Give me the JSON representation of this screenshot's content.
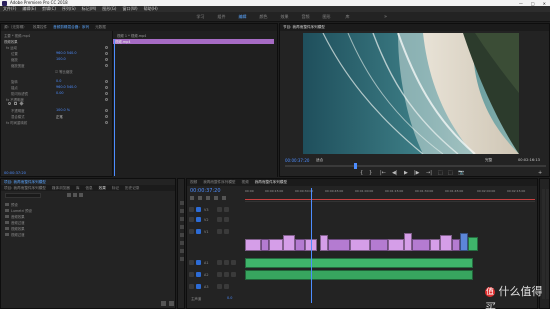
{
  "app": {
    "title": "Adobe Premiere Pro CC 2018",
    "menu": [
      "文件(F)",
      "编辑(E)",
      "剪辑(C)",
      "序列(S)",
      "标记(M)",
      "图形(G)",
      "窗口(W)",
      "帮助(H)"
    ],
    "window_buttons": [
      "—",
      "□",
      "✕"
    ]
  },
  "workspaces": {
    "tabs": [
      "学习",
      "组件",
      "编辑",
      "颜色",
      "效果",
      "音频",
      "图形",
      "库"
    ],
    "active": "编辑",
    "more": "»"
  },
  "effect_controls": {
    "tabs": [
      "源:（无剪辑）",
      "效果控件",
      "音频剪辑混合器：序列",
      "元数据"
    ],
    "header_left": "主要 * 视频.mp4",
    "header_right": "视频 1 * 视频.mp4",
    "clip_label": "视频.mp4",
    "section_video": "视频效果",
    "rows": [
      {
        "label": "fx 运动",
        "value": ""
      },
      {
        "label": "位置",
        "value": "960.0  540.0"
      },
      {
        "label": "缩放",
        "value": "100.0"
      },
      {
        "label": "缩放宽度",
        "value": ""
      },
      {
        "label": "☑ 等比缩放",
        "value": ""
      },
      {
        "label": "旋转",
        "value": "0.0"
      },
      {
        "label": "锚点",
        "value": "960.0  540.0"
      },
      {
        "label": "防闪烁滤镜",
        "value": "0.00"
      },
      {
        "label": "fx 不透明度",
        "value": ""
      },
      {
        "label": "不透明度",
        "value": "100.0 %"
      },
      {
        "label": "混合模式",
        "value": "正常"
      },
      {
        "label": "fx 时间重映射",
        "value": ""
      }
    ],
    "timecode": "00:00:37:20"
  },
  "program_monitor": {
    "tab": "节目: 我再而整件序列模型",
    "timecode_left": "00:00:37:20",
    "fit": "适合",
    "ratio": "完整",
    "timecode_right": "00:02:16:13",
    "controls": [
      "{",
      "}",
      "|←",
      "◀|",
      "▶",
      "|▶",
      "→|",
      "⬚",
      "⬚",
      "📷",
      "+"
    ]
  },
  "project": {
    "tabs": [
      "项目: 我再而整件序列模型",
      "媒体浏览器",
      "库",
      "信息",
      "效果",
      "标记",
      "历史记录"
    ],
    "search_placeholder": "",
    "folders": [
      "预设",
      "Lumetri 预设",
      "音频效果",
      "音频过渡",
      "视频效果",
      "视频过渡"
    ]
  },
  "timeline": {
    "tabs": [
      "视频",
      "我再而整件序列模型",
      "视频",
      "我再而整件序列模型"
    ],
    "timecode": "00:00:37:20",
    "ruler": [
      "00:00",
      "00:00:15:00",
      "00:00:30:00",
      "00:00:45:00",
      "00:01:00:00",
      "00:01:15:00",
      "00:01:30:00",
      "00:01:45:00",
      "00:02:00:00",
      "00:02:15:00"
    ],
    "tracks": [
      {
        "id": "V3",
        "type": "video"
      },
      {
        "id": "V2",
        "type": "video"
      },
      {
        "id": "V1",
        "type": "video"
      },
      {
        "id": "A1",
        "type": "audio"
      },
      {
        "id": "A2",
        "type": "audio"
      },
      {
        "id": "A3",
        "type": "audio"
      },
      {
        "id": "主声道",
        "type": "master",
        "value": "0.0"
      }
    ]
  },
  "watermark": "什么值得买",
  "colors": {
    "accent_blue": "#4d8dff",
    "video_clip": "#d59ee8",
    "audio_clip": "#3fb56b",
    "playhead": "#4d8dff"
  }
}
